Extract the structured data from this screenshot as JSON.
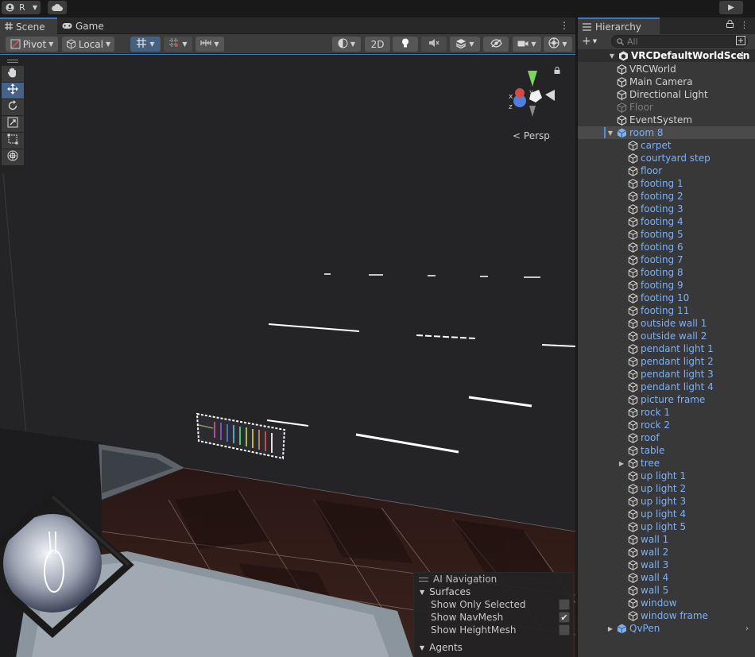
{
  "topbar": {
    "account_initial": "R",
    "play_glyph": "▶"
  },
  "scene_panel": {
    "tabs": [
      {
        "label": "Scene",
        "icon": "grid-icon"
      },
      {
        "label": "Game",
        "icon": "gamepad-icon"
      }
    ],
    "toolbar": {
      "pivot_label": "Pivot",
      "local_label": "Local",
      "mode_2d_label": "2D"
    },
    "camera_mode": "Persp",
    "ai_navigation": {
      "title": "AI Navigation",
      "surfaces_label": "Surfaces",
      "options": [
        {
          "label": "Show Only Selected",
          "checked": false
        },
        {
          "label": "Show NavMesh",
          "checked": true
        },
        {
          "label": "Show HeightMesh",
          "checked": false
        }
      ],
      "agents_label": "Agents"
    }
  },
  "hierarchy": {
    "tab_label": "Hierarchy",
    "search_placeholder": "All",
    "scene_name": "VRCDefaultWorldScen",
    "items": [
      {
        "label": "VRCWorld",
        "depth": 1,
        "style": "normal"
      },
      {
        "label": "Main Camera",
        "depth": 1,
        "style": "normal"
      },
      {
        "label": "Directional Light",
        "depth": 1,
        "style": "normal"
      },
      {
        "label": "Floor",
        "depth": 1,
        "style": "disabled"
      },
      {
        "label": "EventSystem",
        "depth": 1,
        "style": "normal"
      },
      {
        "label": "room 8",
        "depth": 1,
        "style": "prefab-root",
        "expanded": true,
        "selected": true
      },
      {
        "label": "carpet",
        "depth": 2,
        "style": "prefab"
      },
      {
        "label": "courtyard step",
        "depth": 2,
        "style": "prefab"
      },
      {
        "label": "floor",
        "depth": 2,
        "style": "prefab"
      },
      {
        "label": "footing 1",
        "depth": 2,
        "style": "prefab"
      },
      {
        "label": "footing 2",
        "depth": 2,
        "style": "prefab"
      },
      {
        "label": "footing 3",
        "depth": 2,
        "style": "prefab"
      },
      {
        "label": "footing 4",
        "depth": 2,
        "style": "prefab"
      },
      {
        "label": "footing 5",
        "depth": 2,
        "style": "prefab"
      },
      {
        "label": "footing 6",
        "depth": 2,
        "style": "prefab"
      },
      {
        "label": "footing 7",
        "depth": 2,
        "style": "prefab"
      },
      {
        "label": "footing 8",
        "depth": 2,
        "style": "prefab"
      },
      {
        "label": "footing 9",
        "depth": 2,
        "style": "prefab"
      },
      {
        "label": "footing 10",
        "depth": 2,
        "style": "prefab"
      },
      {
        "label": "footing 11",
        "depth": 2,
        "style": "prefab"
      },
      {
        "label": "outside wall 1",
        "depth": 2,
        "style": "prefab"
      },
      {
        "label": "outside wall 2",
        "depth": 2,
        "style": "prefab"
      },
      {
        "label": "pendant light 1",
        "depth": 2,
        "style": "prefab"
      },
      {
        "label": "pendant light 2",
        "depth": 2,
        "style": "prefab"
      },
      {
        "label": "pendant light 3",
        "depth": 2,
        "style": "prefab"
      },
      {
        "label": "pendant light 4",
        "depth": 2,
        "style": "prefab"
      },
      {
        "label": "picture frame",
        "depth": 2,
        "style": "prefab"
      },
      {
        "label": "rock 1",
        "depth": 2,
        "style": "prefab"
      },
      {
        "label": "rock 2",
        "depth": 2,
        "style": "prefab"
      },
      {
        "label": "roof",
        "depth": 2,
        "style": "prefab"
      },
      {
        "label": "table",
        "depth": 2,
        "style": "prefab"
      },
      {
        "label": "tree",
        "depth": 2,
        "style": "prefab",
        "collapsed": true
      },
      {
        "label": "up light 1",
        "depth": 2,
        "style": "prefab"
      },
      {
        "label": "up light 2",
        "depth": 2,
        "style": "prefab"
      },
      {
        "label": "up light 3",
        "depth": 2,
        "style": "prefab"
      },
      {
        "label": "up light 4",
        "depth": 2,
        "style": "prefab"
      },
      {
        "label": "up light 5",
        "depth": 2,
        "style": "prefab"
      },
      {
        "label": "wall 1",
        "depth": 2,
        "style": "prefab"
      },
      {
        "label": "wall 2",
        "depth": 2,
        "style": "prefab"
      },
      {
        "label": "wall 3",
        "depth": 2,
        "style": "prefab"
      },
      {
        "label": "wall 4",
        "depth": 2,
        "style": "prefab"
      },
      {
        "label": "wall 5",
        "depth": 2,
        "style": "prefab"
      },
      {
        "label": "window",
        "depth": 2,
        "style": "prefab"
      },
      {
        "label": "window frame",
        "depth": 2,
        "style": "prefab"
      },
      {
        "label": "QvPen",
        "depth": 1,
        "style": "prefab-root",
        "collapsed": true
      }
    ]
  },
  "colors": {
    "accent": "#3a79bb",
    "prefab_text": "#7fb0f5",
    "panel_bg": "#383838",
    "viewport_bg": "#242427"
  }
}
